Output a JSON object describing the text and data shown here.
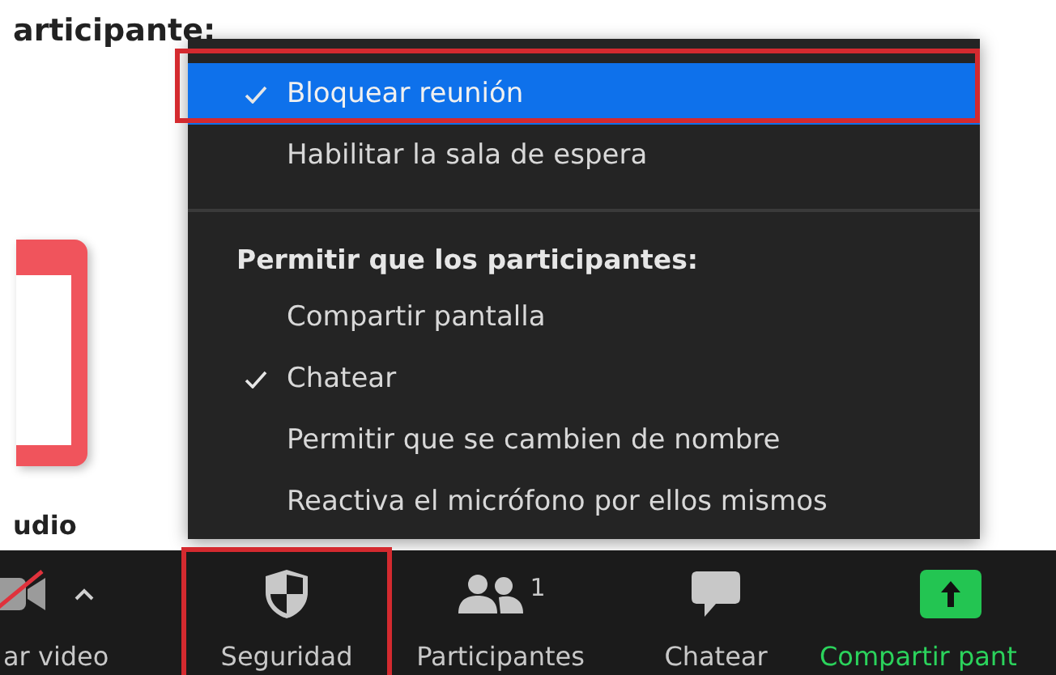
{
  "background": {
    "heading": "articipante:",
    "label": "udio"
  },
  "menu": {
    "items": [
      {
        "kind": "item",
        "label": "Bloquear reunión",
        "checked": true,
        "selected": true
      },
      {
        "kind": "item",
        "label": "Habilitar la sala de espera",
        "checked": false,
        "selected": false
      },
      {
        "kind": "divider"
      },
      {
        "kind": "header",
        "label": "Permitir que los participantes:"
      },
      {
        "kind": "item",
        "label": "Compartir pantalla",
        "checked": false,
        "selected": false
      },
      {
        "kind": "item",
        "label": "Chatear",
        "checked": true,
        "selected": false
      },
      {
        "kind": "item",
        "label": "Permitir que se cambien de nombre",
        "checked": false,
        "selected": false
      },
      {
        "kind": "item",
        "label": "Reactiva el micrófono por ellos mismos",
        "checked": false,
        "selected": false
      }
    ]
  },
  "toolbar": {
    "buttons": [
      {
        "kind": "video",
        "label": "ar video"
      },
      {
        "kind": "security",
        "label": "Seguridad",
        "selected": true
      },
      {
        "kind": "participants",
        "label": "Participantes",
        "count": "1"
      },
      {
        "kind": "chat",
        "label": "Chatear"
      },
      {
        "kind": "share",
        "label": "Compartir pant"
      }
    ]
  }
}
